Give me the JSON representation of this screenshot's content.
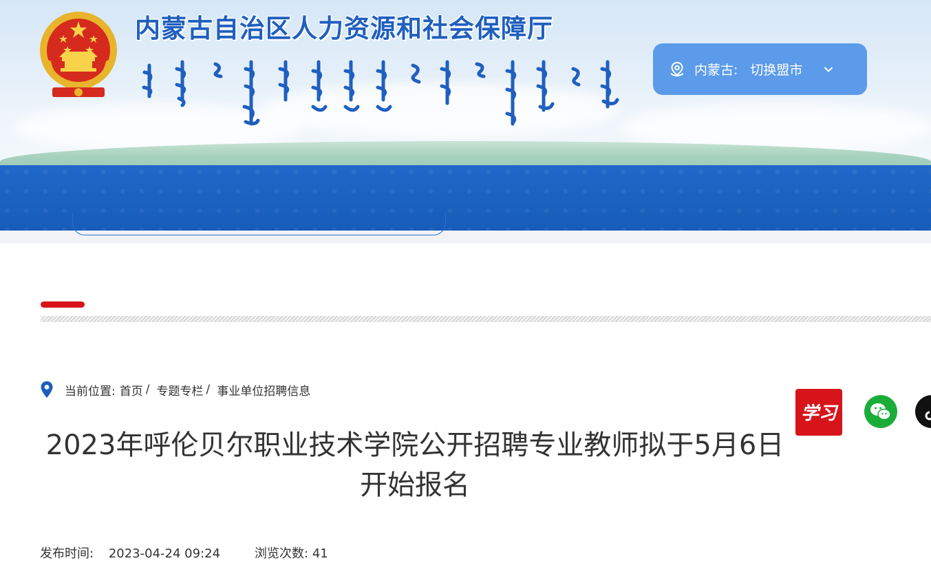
{
  "header": {
    "site_title": "内蒙古自治区人力资源和社会保障厅",
    "region_switch": {
      "region_label": "内蒙古:",
      "switch_label": "切换盟市",
      "location_icon": "location-pin-icon",
      "chevron_icon": "chevron-down-icon"
    },
    "emblem": "national-emblem-icon"
  },
  "breadcrumb": {
    "prefix": "当前位置:",
    "items": [
      {
        "label": "首页"
      },
      {
        "label": "专题专栏"
      },
      {
        "label": "事业单位招聘信息"
      }
    ],
    "separator": "/"
  },
  "article": {
    "title": "2023年呼伦贝尔职业技术学院公开招聘专业教师拟于5月6日开始报名",
    "publish_label": "发布时间:",
    "publish_time": "2023-04-24 09:24",
    "views_label": "浏览次数:",
    "views_count": "41"
  },
  "share": {
    "xuexi": "学习",
    "icons": [
      "xuexi-icon",
      "wechat-icon",
      "tiktok-icon"
    ]
  },
  "colors": {
    "primary_blue": "#1a5fbe",
    "switch_blue": "#5b9be9",
    "accent_red": "#d7141a",
    "wechat_green": "#1aad3a"
  }
}
